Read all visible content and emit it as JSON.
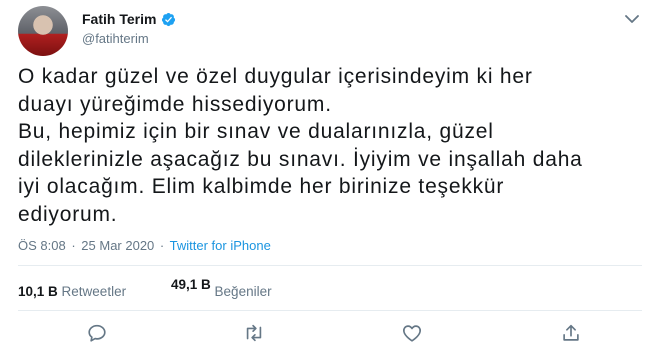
{
  "author": {
    "name": "Fatih Terim",
    "handle": "@fatihterim"
  },
  "tweet": {
    "text": "O kadar güzel ve özel duygular içerisindeyim ki her\nduayı yüreğimde hissediyorum.\nBu, hepimiz için bir sınav ve dualarınızla, güzel\ndileklerinizle aşacağız bu sınavı. İyiyim ve inşallah daha\niyi olacağım. Elim kalbimde her birinize teşekkür\nediyorum.",
    "time": "ÖS 8:08",
    "separator": "·",
    "date": "25 Mar 2020",
    "source": "Twitter for iPhone"
  },
  "stats": {
    "retweets_count": "10,1 B",
    "retweets_label": "Retweetler",
    "likes_count": "49,1 B",
    "likes_label": "Beğeniler"
  },
  "icons": {
    "verified": "verified-badge-icon",
    "menu": "chevron-down-icon",
    "reply": "reply-icon",
    "retweet": "retweet-icon",
    "like": "heart-icon",
    "share": "share-icon"
  },
  "colors": {
    "accent": "#1da1f2",
    "link": "#1b95e0",
    "muted": "#657786",
    "text": "#14171a"
  }
}
